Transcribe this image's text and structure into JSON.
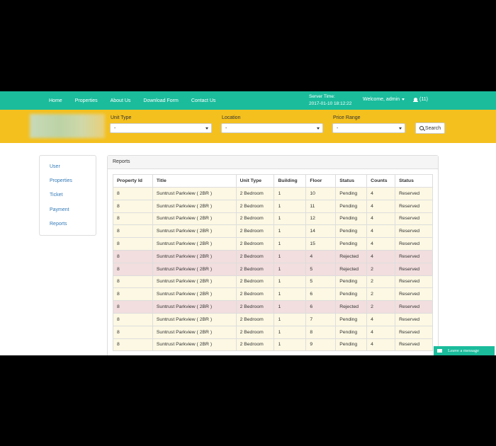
{
  "nav": {
    "links": [
      "Home",
      "Properties",
      "About Us",
      "Download Form",
      "Contact Us"
    ],
    "server_time_label": "Server Time:",
    "server_time_value": "2017-01-10 18:12:22",
    "welcome": "Welcome, admin",
    "notifications": "(11)"
  },
  "search": {
    "unit_type_label": "Unit Type",
    "unit_type_value": "-",
    "location_label": "Location",
    "location_value": "-",
    "price_range_label": "Price Range",
    "price_range_value": "-",
    "button_label": "Search"
  },
  "sidebar": {
    "items": [
      "User",
      "Properties",
      "Ticket",
      "Payment",
      "Reports"
    ]
  },
  "reports": {
    "title": "Reports",
    "columns": [
      "Property Id",
      "Title",
      "Unit Type",
      "Building",
      "Floor",
      "Status",
      "Counts",
      "Status"
    ],
    "rows": [
      [
        "8",
        "Suntrust Parkview ( 2BR )",
        "2 Bedroom",
        "1",
        "10",
        "Pending",
        "4",
        "Reserved"
      ],
      [
        "8",
        "Suntrust Parkview ( 2BR )",
        "2 Bedroom",
        "1",
        "11",
        "Pending",
        "4",
        "Reserved"
      ],
      [
        "8",
        "Suntrust Parkview ( 2BR )",
        "2 Bedroom",
        "1",
        "12",
        "Pending",
        "4",
        "Reserved"
      ],
      [
        "8",
        "Suntrust Parkview ( 2BR )",
        "2 Bedroom",
        "1",
        "14",
        "Pending",
        "4",
        "Reserved"
      ],
      [
        "8",
        "Suntrust Parkview ( 2BR )",
        "2 Bedroom",
        "1",
        "15",
        "Pending",
        "4",
        "Reserved"
      ],
      [
        "8",
        "Suntrust Parkview ( 2BR )",
        "2 Bedroom",
        "1",
        "4",
        "Rejected",
        "4",
        "Reserved"
      ],
      [
        "8",
        "Suntrust Parkview ( 2BR )",
        "2 Bedroom",
        "1",
        "5",
        "Rejected",
        "2",
        "Reserved"
      ],
      [
        "8",
        "Suntrust Parkview ( 2BR )",
        "2 Bedroom",
        "1",
        "5",
        "Pending",
        "2",
        "Reserved"
      ],
      [
        "8",
        "Suntrust Parkview ( 2BR )",
        "2 Bedroom",
        "1",
        "6",
        "Pending",
        "2",
        "Reserved"
      ],
      [
        "8",
        "Suntrust Parkview ( 2BR )",
        "2 Bedroom",
        "1",
        "6",
        "Rejected",
        "2",
        "Reserved"
      ],
      [
        "8",
        "Suntrust Parkview ( 2BR )",
        "2 Bedroom",
        "1",
        "7",
        "Pending",
        "4",
        "Reserved"
      ],
      [
        "8",
        "Suntrust Parkview ( 2BR )",
        "2 Bedroom",
        "1",
        "8",
        "Pending",
        "4",
        "Reserved"
      ],
      [
        "8",
        "Suntrust Parkview ( 2BR )",
        "2 Bedroom",
        "1",
        "9",
        "Pending",
        "4",
        "Reserved"
      ]
    ]
  },
  "chat": {
    "label": "Leave a message"
  },
  "colors": {
    "navbar": "#1abc9c",
    "searchbar": "#f4c01e",
    "pending_row": "#fcf8e3",
    "rejected_row": "#f2dede",
    "link": "#337ab7"
  },
  "icons": {
    "notifications": "bell-icon",
    "search": "search-icon",
    "chat": "envelope-icon",
    "dropdown": "caret-down-icon"
  }
}
